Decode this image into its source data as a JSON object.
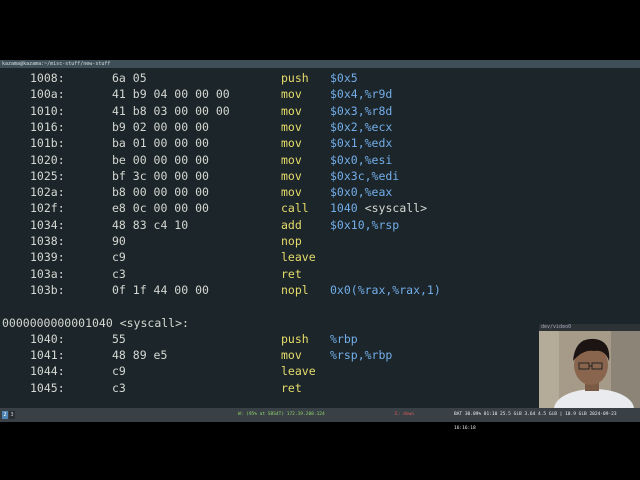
{
  "window": {
    "title": "kazama@kazama:~/misc-stuff/new-stuff"
  },
  "disassembly": [
    {
      "addr": "1008:",
      "bytes": "6a 05",
      "mnemonic": "push",
      "operand": "$0x5"
    },
    {
      "addr": "100a:",
      "bytes": "41 b9 04 00 00 00",
      "mnemonic": "mov",
      "operand": "$0x4,%r9d"
    },
    {
      "addr": "1010:",
      "bytes": "41 b8 03 00 00 00",
      "mnemonic": "mov",
      "operand": "$0x3,%r8d"
    },
    {
      "addr": "1016:",
      "bytes": "b9 02 00 00 00",
      "mnemonic": "mov",
      "operand": "$0x2,%ecx"
    },
    {
      "addr": "101b:",
      "bytes": "ba 01 00 00 00",
      "mnemonic": "mov",
      "operand": "$0x1,%edx"
    },
    {
      "addr": "1020:",
      "bytes": "be 00 00 00 00",
      "mnemonic": "mov",
      "operand": "$0x0,%esi"
    },
    {
      "addr": "1025:",
      "bytes": "bf 3c 00 00 00",
      "mnemonic": "mov",
      "operand": "$0x3c,%edi"
    },
    {
      "addr": "102a:",
      "bytes": "b8 00 00 00 00",
      "mnemonic": "mov",
      "operand": "$0x0,%eax"
    },
    {
      "addr": "102f:",
      "bytes": "e8 0c 00 00 00",
      "mnemonic": "call",
      "operand": "1040",
      "symbol": "<syscall>"
    },
    {
      "addr": "1034:",
      "bytes": "48 83 c4 10",
      "mnemonic": "add",
      "operand": "$0x10,%rsp"
    },
    {
      "addr": "1038:",
      "bytes": "90",
      "mnemonic": "nop",
      "operand": ""
    },
    {
      "addr": "1039:",
      "bytes": "c9",
      "mnemonic": "leave",
      "operand": ""
    },
    {
      "addr": "103a:",
      "bytes": "c3",
      "mnemonic": "ret",
      "operand": ""
    },
    {
      "addr": "103b:",
      "bytes": "0f 1f 44 00 00",
      "mnemonic": "nopl",
      "operand": "0x0(%rax,%rax,1)"
    }
  ],
  "function_header": "0000000000001040 <syscall>:",
  "syscall_disassembly": [
    {
      "addr": "1040:",
      "bytes": "55",
      "mnemonic": "push",
      "operand": "%rbp"
    },
    {
      "addr": "1041:",
      "bytes": "48 89 e5",
      "mnemonic": "mov",
      "operand": "%rsp,%rbp"
    },
    {
      "addr": "1044:",
      "bytes": "c9",
      "mnemonic": "leave",
      "operand": ""
    },
    {
      "addr": "1045:",
      "bytes": "c3",
      "mnemonic": "ret",
      "operand": ""
    }
  ],
  "webcam": {
    "label": "dev/video0"
  },
  "statusbar": {
    "workspaces": [
      "2",
      "3"
    ],
    "network": "W: (95% at SBS4T) 172.19.208.124",
    "ip_info": "E: down",
    "right": "BAT 30.09% 01:10 25.5 GiB 3.64 4.5 GiB | 10.9 GiB 2024-09-23 16:16:18"
  }
}
